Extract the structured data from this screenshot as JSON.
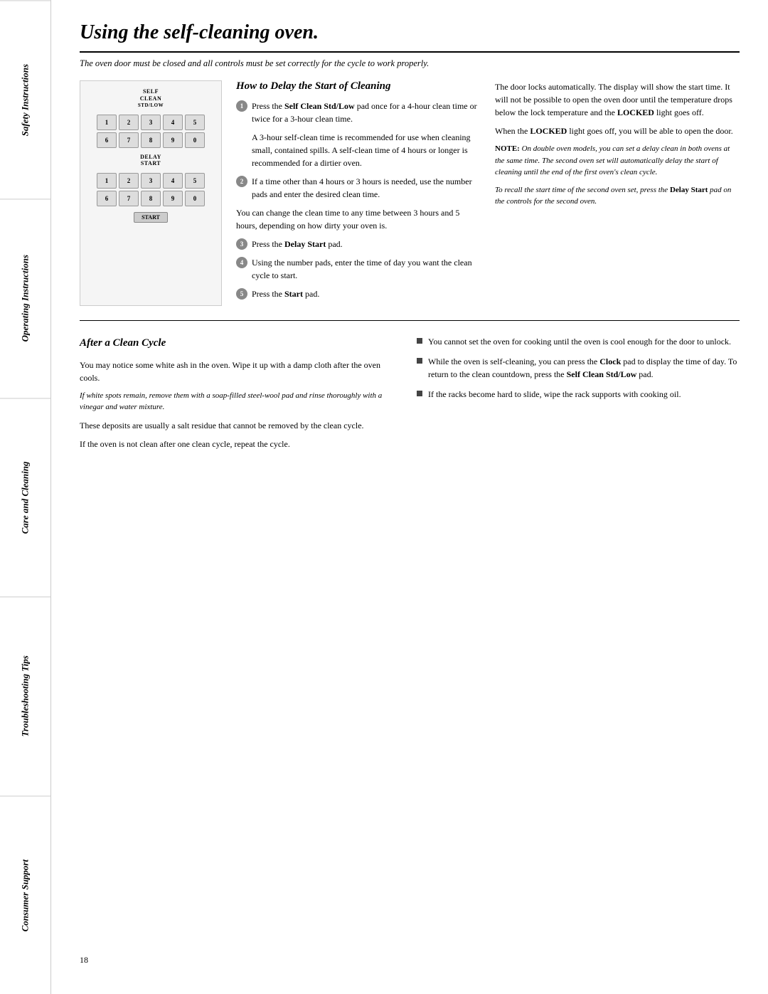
{
  "sidebar": {
    "items": [
      {
        "label": "Safety Instructions"
      },
      {
        "label": "Operating Instructions"
      },
      {
        "label": "Care and Cleaning"
      },
      {
        "label": "Troubleshooting Tips"
      },
      {
        "label": "Consumer Support"
      }
    ]
  },
  "page": {
    "title": "Using the self-cleaning oven.",
    "subtitle": "The oven door must be closed and all controls must be set correctly for the cycle to work properly.",
    "page_number": "18"
  },
  "delay_section": {
    "title": "How to Delay the Start of Cleaning",
    "step1": "Press the Self Clean Std/Low pad once for a 4-hour clean time or twice for a 3-hour clean time.",
    "step1_note": "A 3-hour self-clean time is recommended for use when cleaning small, contained spills. A self-clean time of 4 hours or longer is recommended for a dirtier oven.",
    "para1": "You can change the clean time to any time between 3 hours and 5 hours, depending on how dirty your oven is.",
    "step3": "Press the Delay Start pad.",
    "step4": "Using the number pads, enter the time of day you want the clean cycle to start.",
    "step5": "Press the Start pad.",
    "step2": "If a time other than 4 hours or 3 hours is needed, use the number pads and enter the desired clean time."
  },
  "right_col": {
    "para1": "The door locks automatically. The display will show the start time. It will not be possible to open the oven door until the temperature drops below the lock temperature and the LOCKED light goes off.",
    "para2": "When the LOCKED light goes off, you will be able to open the door.",
    "note_label": "NOTE:",
    "note": "On double oven models, you can set a delay clean in both ovens at the same time. The second oven set will automatically delay the start of cleaning until the end of the first oven's clean cycle.",
    "recall_para": "To recall the start time of the second oven set, press the Delay Start pad on the controls for the second oven."
  },
  "after_section": {
    "title": "After a Clean Cycle",
    "para1": "You may notice some white ash in the oven. Wipe it up with a damp cloth after the oven cools.",
    "note_italic": "If white spots remain, remove them with a soap-filled steel-wool pad and rinse thoroughly with a vinegar and water mixture.",
    "para2": "These deposits are usually a salt residue that cannot be removed by the clean cycle.",
    "para3": "If the oven is not clean after one clean cycle, repeat the cycle.",
    "bullet1": "You cannot set the oven for cooking until the oven is cool enough for the door to unlock.",
    "bullet2": "While the oven is self-cleaning, you can press the Clock pad to display the time of day. To return to the clean countdown, press the Self Clean Std/Low pad.",
    "bullet3": "If the racks become hard to slide, wipe the rack supports with cooking oil."
  },
  "diagram": {
    "label1": "Self\nClean\nStd/Low",
    "keys_row1": [
      "1",
      "2",
      "3",
      "4",
      "5"
    ],
    "keys_row2": [
      "6",
      "7",
      "8",
      "9",
      "0"
    ],
    "label2": "Delay\nStart",
    "keys_row3": [
      "1",
      "2",
      "3",
      "4",
      "5"
    ],
    "keys_row4": [
      "6",
      "7",
      "8",
      "9",
      "0"
    ],
    "start": "Start"
  }
}
